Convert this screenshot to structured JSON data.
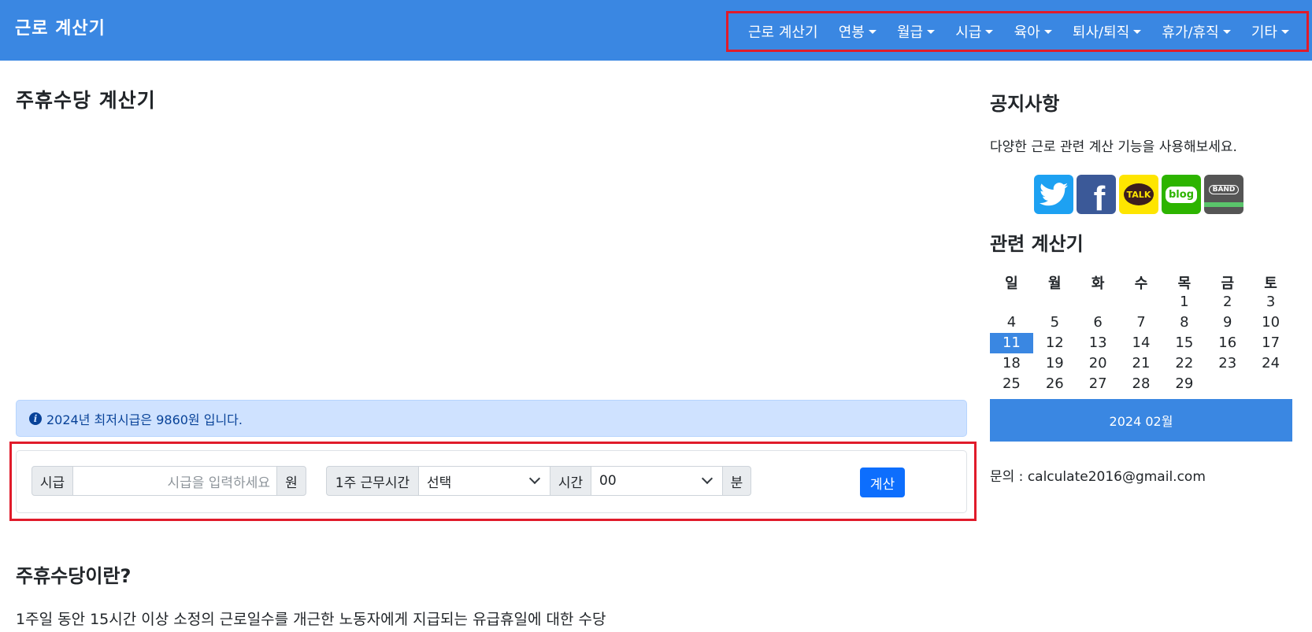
{
  "brand": "근로 계산기",
  "nav": {
    "items": [
      {
        "label": "근로 계산기",
        "dropdown": false
      },
      {
        "label": "연봉",
        "dropdown": true
      },
      {
        "label": "월급",
        "dropdown": true
      },
      {
        "label": "시급",
        "dropdown": true
      },
      {
        "label": "육아",
        "dropdown": true
      },
      {
        "label": "퇴사/퇴직",
        "dropdown": true
      },
      {
        "label": "휴가/휴직",
        "dropdown": true
      },
      {
        "label": "기타",
        "dropdown": true
      }
    ]
  },
  "main": {
    "title": "주휴수당 계산기",
    "alert": "2024년 최저시급은 9860원 입니다.",
    "form": {
      "wage_label": "시급",
      "wage_placeholder": "시급을 입력하세요",
      "wage_unit": "원",
      "hours_label": "1주 근무시간",
      "hours_value": "선택",
      "hours_unit": "시간",
      "minutes_value": "00",
      "minutes_unit": "분",
      "submit_label": "계산"
    },
    "section_title": "주휴수당이란?",
    "section_text": "1주일 동안 15시간 이상 소정의 근로일수를 개근한 노동자에게 지급되는 유급휴일에 대한 수당"
  },
  "sidebar": {
    "notice_title": "공지사항",
    "notice_text": "다양한 근로 관련 계산 기능을 사용해보세요.",
    "socials": [
      {
        "icon": "twitter-icon",
        "color": "#1da1f2"
      },
      {
        "icon": "facebook-icon",
        "color": "#3b5998",
        "text": "f"
      },
      {
        "icon": "kakaotalk-icon",
        "color": "#fee500",
        "text": "TALK"
      },
      {
        "icon": "blog-icon",
        "color": "#2db400",
        "text": "blog"
      },
      {
        "icon": "band-icon",
        "color": "#555555",
        "text": "BAND"
      }
    ],
    "related_title": "관련 계산기",
    "calendar": {
      "weekdays": [
        "일",
        "월",
        "화",
        "수",
        "목",
        "금",
        "토"
      ],
      "weeks": [
        [
          "",
          "",
          "",
          "",
          "1",
          "2",
          "3"
        ],
        [
          "4",
          "5",
          "6",
          "7",
          "8",
          "9",
          "10"
        ],
        [
          "11",
          "12",
          "13",
          "14",
          "15",
          "16",
          "17"
        ],
        [
          "18",
          "19",
          "20",
          "21",
          "22",
          "23",
          "24"
        ],
        [
          "25",
          "26",
          "27",
          "28",
          "29",
          "",
          ""
        ]
      ],
      "today": "11",
      "footer": "2024 02월"
    },
    "contact": "문의 : calculate2016@gmail.com"
  }
}
